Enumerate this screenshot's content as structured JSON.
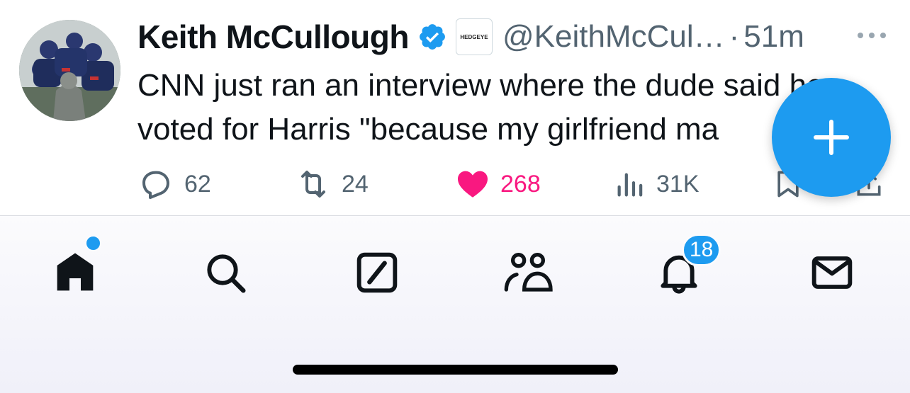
{
  "tweet": {
    "author_name": "Keith McCullough",
    "affiliation_badge": "HEDGEYE",
    "handle": "@KeithMcCul…",
    "separator": "·",
    "time": "51m",
    "text_line1": "CNN just ran an interview where the dude said he",
    "text_line2": "voted for Harris \"because my girlfriend ma",
    "replies": "62",
    "retweets": "24",
    "likes": "268",
    "views": "31K"
  },
  "tabbar": {
    "notifications_badge": "18",
    "items": [
      "home",
      "search",
      "grok",
      "communities",
      "notifications",
      "messages"
    ]
  },
  "colors": {
    "accent": "#1d9bf0",
    "like": "#f91880",
    "secondary_text": "#536471",
    "primary_text": "#0f1419"
  },
  "icons": {
    "reply": "reply-icon",
    "retweet": "retweet-icon",
    "like": "heart-icon",
    "views": "views-icon",
    "bookmark": "bookmark-icon",
    "share": "share-icon",
    "compose": "plus-icon"
  }
}
